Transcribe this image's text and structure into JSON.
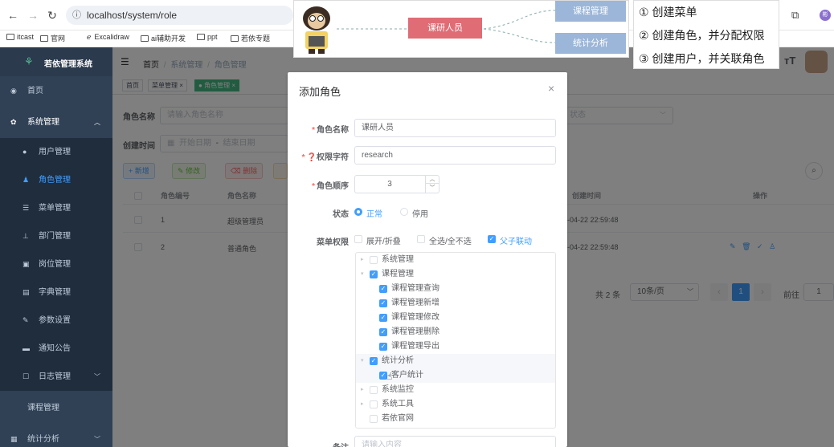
{
  "browser": {
    "url": "localhost/system/role",
    "profile_initial": "彬"
  },
  "bookmarks": [
    "itcast",
    "官网",
    "Excalidraw",
    "ai辅助开发",
    "ppt",
    "若依专题"
  ],
  "sidebar": {
    "logo_title": "若依管理系统",
    "items": [
      {
        "label": "首页"
      },
      {
        "label": "系统管理"
      },
      {
        "label": "用户管理"
      },
      {
        "label": "角色管理"
      },
      {
        "label": "菜单管理"
      },
      {
        "label": "部门管理"
      },
      {
        "label": "岗位管理"
      },
      {
        "label": "字典管理"
      },
      {
        "label": "参数设置"
      },
      {
        "label": "通知公告"
      },
      {
        "label": "日志管理"
      },
      {
        "label": "课程管理"
      },
      {
        "label": "统计分析"
      }
    ]
  },
  "breadcrumb": {
    "home": "首页",
    "sep": "/",
    "level1": "系统管理",
    "level2": "角色管理"
  },
  "tags": [
    {
      "label": "首页"
    },
    {
      "label": "菜单管理"
    },
    {
      "label": "角色管理"
    }
  ],
  "search": {
    "role_name_label": "角色名称",
    "role_name_placeholder": "请输入角色名称",
    "status_placeholder": "状态",
    "create_time_label": "创建时间",
    "start_placeholder": "开始日期",
    "date_sep": "-",
    "end_placeholder": "结束日期"
  },
  "actions": {
    "add": "+ 新增",
    "edit": "修改",
    "delete": "删除"
  },
  "table": {
    "headers": [
      "角色编号",
      "角色名称",
      "创建时间",
      "操作"
    ],
    "rows": [
      {
        "id": "1",
        "name": "超级管理员",
        "time": "-04-22 22:59:48"
      },
      {
        "id": "2",
        "name": "普通角色",
        "time": "-04-22 22:59:48"
      }
    ]
  },
  "pagination": {
    "total": "共 2 条",
    "page_size": "10条/页",
    "current": "1",
    "goto": "前往",
    "goto_value": "1"
  },
  "dialog": {
    "title": "添加角色",
    "name_label": "角色名称",
    "name_value": "课研人员",
    "key_label": "权限字符",
    "key_value": "research",
    "order_label": "角色顺序",
    "order_value": "3",
    "status_label": "状态",
    "status_normal": "正常",
    "status_disabled": "停用",
    "menu_label": "菜单权限",
    "expand": "展开/折叠",
    "select_all": "全选/全不选",
    "linkage": "父子联动",
    "remark_label": "备注",
    "remark_placeholder": "请输入内容",
    "tree": [
      {
        "label": "系统管理"
      },
      {
        "label": "课程管理"
      },
      {
        "label": "课程管理查询"
      },
      {
        "label": "课程管理新增"
      },
      {
        "label": "课程管理修改"
      },
      {
        "label": "课程管理删除"
      },
      {
        "label": "课程管理导出"
      },
      {
        "label": "统计分析"
      },
      {
        "label": "客户统计"
      },
      {
        "label": "系统监控"
      },
      {
        "label": "系统工具"
      },
      {
        "label": "若依官网"
      }
    ]
  },
  "diagram": {
    "role": "课研人员",
    "menu1": "课程管理",
    "menu2": "统计分析"
  },
  "steps": [
    "① 创建菜单",
    "② 创建角色，并分配权限",
    "③ 创建用户，并关联角色"
  ],
  "colors": {
    "accent": "#409eff",
    "sidebar": "#304156",
    "tag_active": "#42b983",
    "diagram_role": "#e06c75",
    "diagram_menu": "#9bb6d8"
  }
}
